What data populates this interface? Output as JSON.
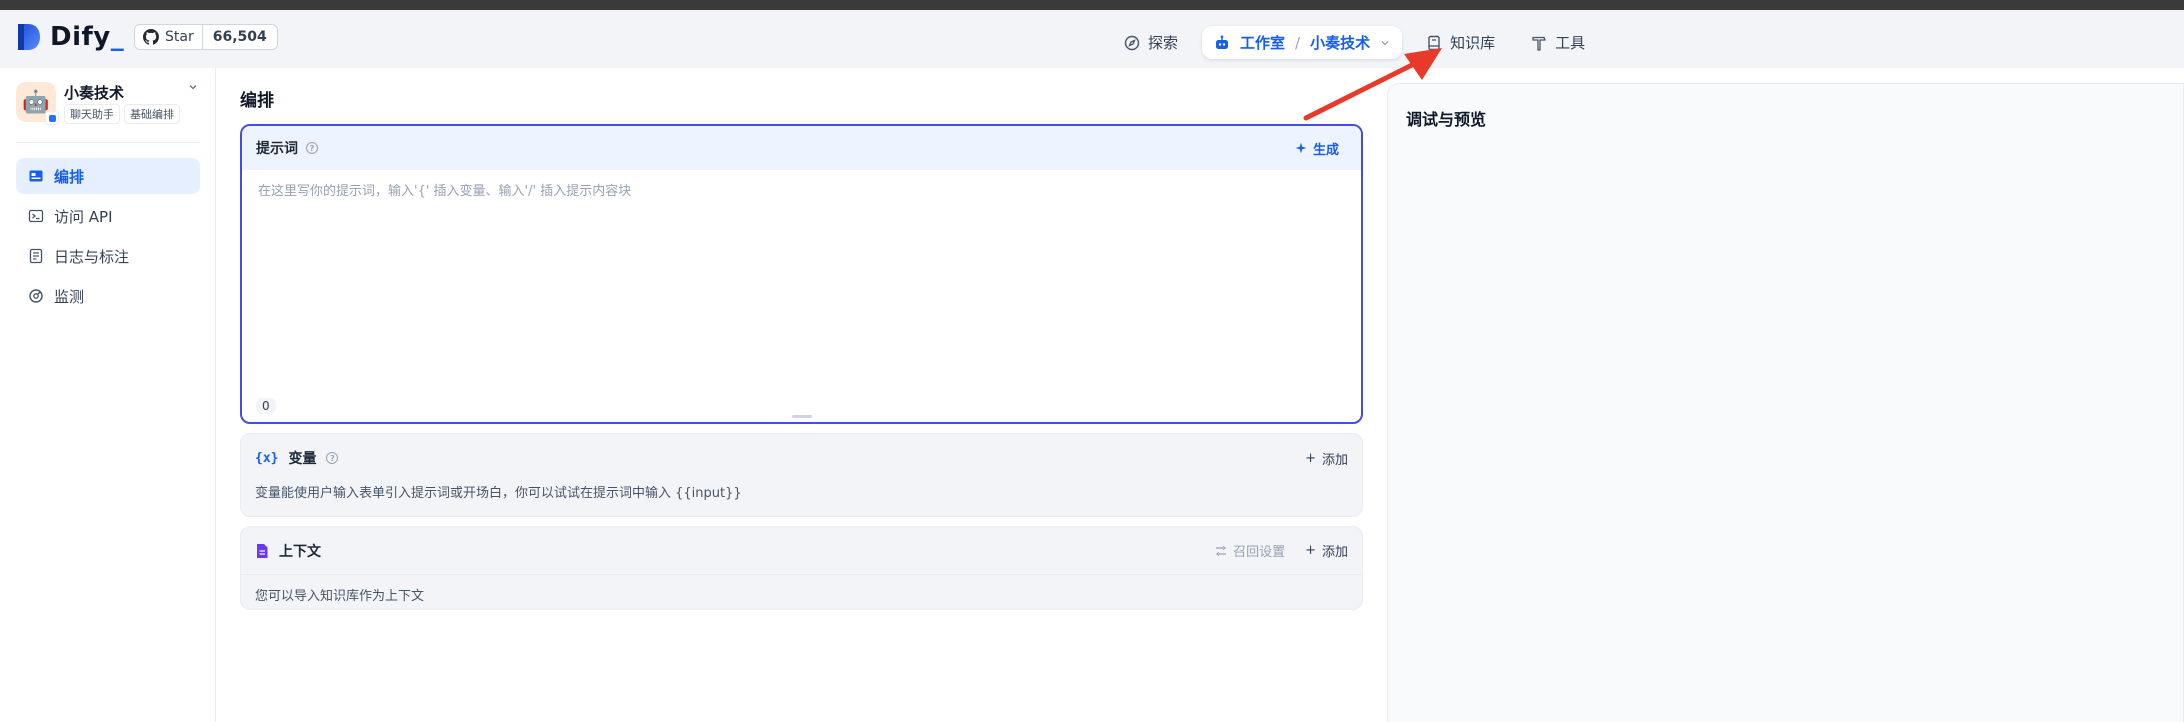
{
  "brand": {
    "name": "Dify",
    "underscore": "_",
    "accent": "#155eef"
  },
  "github": {
    "label": "Star",
    "count": "66,504"
  },
  "nav": {
    "explore": "探索",
    "studio": "工作室",
    "studio_app": "小奏技术",
    "knowledge": "知识库",
    "tools": "工具"
  },
  "app": {
    "name": "小奏技术",
    "avatar_emoji": "🤖",
    "tags": [
      "聊天助手",
      "基础编排"
    ]
  },
  "sidebar": {
    "items": [
      {
        "label": "编排",
        "icon": "layout-icon",
        "active": true
      },
      {
        "label": "访问 API",
        "icon": "terminal-icon",
        "active": false
      },
      {
        "label": "日志与标注",
        "icon": "document-icon",
        "active": false
      },
      {
        "label": "监测",
        "icon": "gauge-icon",
        "active": false
      }
    ]
  },
  "main": {
    "title": "编排",
    "prompt": {
      "label": "提示词",
      "generate_label": "生成",
      "placeholder": "在这里写你的提示词，输入'{' 插入变量、输入'/' 插入提示内容块",
      "char_count": "0"
    },
    "variables": {
      "icon_text": "{x}",
      "label": "变量",
      "add_label": "添加",
      "description": "变量能使用户输入表单引入提示词或开场白，你可以试试在提示词中输入 {{input}}"
    },
    "context": {
      "label": "上下文",
      "recall_label": "召回设置",
      "add_label": "添加",
      "description": "您可以导入知识库作为上下文"
    }
  },
  "debug": {
    "title": "调试与预览"
  },
  "colors": {
    "primary": "#155eef",
    "focus_border": "#444ce7",
    "arrow": "#e83a2a"
  }
}
